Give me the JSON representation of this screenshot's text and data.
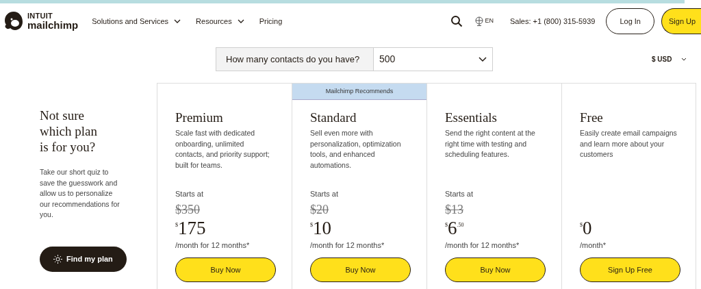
{
  "header": {
    "logo": {
      "brand_top": "INTUIT",
      "brand_bottom": "mailchimp"
    },
    "nav": [
      {
        "label": "Solutions and Services",
        "dropdown": true
      },
      {
        "label": "Resources",
        "dropdown": true
      },
      {
        "label": "Pricing",
        "dropdown": false
      }
    ],
    "language": "EN",
    "sales": "Sales: +1 (800) 315-5939",
    "login": "Log In",
    "signup": "Sign Up"
  },
  "contacts": {
    "label": "How many contacts do you have?",
    "value": "500"
  },
  "currency": "$ USD",
  "quiz": {
    "title": "Not sure which plan is for you?",
    "text": "Take our short quiz to save the guesswork and allow us to personalize our recommendations for you.",
    "button": "Find my plan"
  },
  "plans": [
    {
      "name": "Premium",
      "recommended": false,
      "description": "Scale fast with dedicated onboarding, unlimited contacts, and priority support; built for teams.",
      "starts_at": "Starts at",
      "old_price": "$350",
      "currency": "$",
      "amount": "175",
      "period": "/month for 12 months*",
      "button": "Buy Now"
    },
    {
      "name": "Standard",
      "recommended": true,
      "badge": "Mailchimp Recommends",
      "description": "Sell even more with personalization, optimization tools, and enhanced automations.",
      "starts_at": "Starts at",
      "old_price": "$20",
      "currency": "$",
      "amount": "10",
      "period": "/month for 12 months*",
      "button": "Buy Now"
    },
    {
      "name": "Essentials",
      "recommended": false,
      "description": "Send the right content at the right time with testing and scheduling features.",
      "starts_at": "Starts at",
      "old_price": "$13",
      "currency": "$",
      "amount": "6",
      "cents": ".50",
      "period": "/month for 12 months*",
      "button": "Buy Now"
    },
    {
      "name": "Free",
      "recommended": false,
      "description": "Easily create email campaigns and learn more about your customers",
      "currency": "$",
      "amount": "0",
      "period": "/month*",
      "button": "Sign Up Free"
    }
  ]
}
